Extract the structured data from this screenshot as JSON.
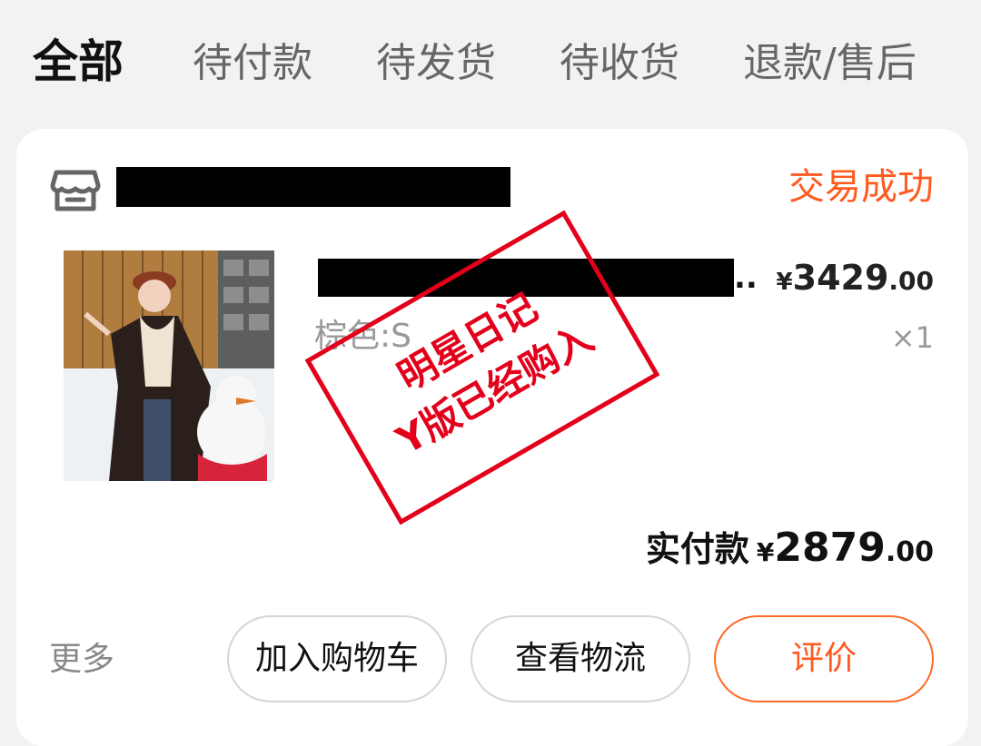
{
  "tabs": [
    {
      "label": "全部",
      "active": true
    },
    {
      "label": "待付款",
      "active": false
    },
    {
      "label": "待发货",
      "active": false
    },
    {
      "label": "待收货",
      "active": false
    },
    {
      "label": "退款/售后",
      "active": false
    }
  ],
  "order": {
    "shop_name": "",
    "status": "交易成功",
    "product": {
      "title_suffix": "...",
      "variant": "棕色:S",
      "price": {
        "currency": "¥",
        "integer": "3429",
        "decimal": ".00"
      },
      "quantity": "×1"
    },
    "paid": {
      "label": "实付款",
      "currency": "¥",
      "integer": "2879",
      "decimal": ".00"
    },
    "actions": {
      "more": "更多",
      "add_to_cart": "加入购物车",
      "view_logistics": "查看物流",
      "review": "评价"
    }
  },
  "stamp": {
    "line1": "明星日记",
    "line2": "Y版已经购入"
  },
  "colors": {
    "accent": "#ff5a1f",
    "stamp": "#e3001b",
    "redaction": "#000000"
  },
  "icons": {
    "shop": "store-icon"
  }
}
